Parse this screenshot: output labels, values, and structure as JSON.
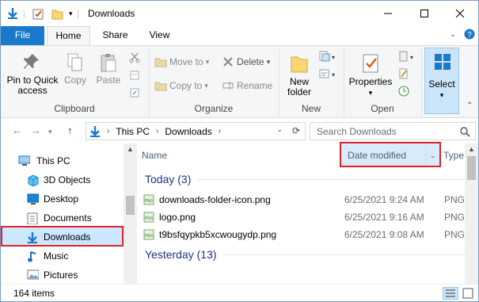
{
  "window": {
    "title": "Downloads"
  },
  "tabs": {
    "file": "File",
    "home": "Home",
    "share": "Share",
    "view": "View"
  },
  "ribbon": {
    "clipboard": {
      "pin_line1": "Pin to Quick",
      "pin_line2": "access",
      "copy": "Copy",
      "paste": "Paste",
      "label": "Clipboard"
    },
    "organize": {
      "move_to": "Move to",
      "copy_to": "Copy to",
      "delete": "Delete",
      "rename": "Rename",
      "label": "Organize"
    },
    "new": {
      "line1": "New",
      "line2": "folder",
      "label": "New"
    },
    "open": {
      "properties": "Properties",
      "label": "Open"
    },
    "select": {
      "label": "Select"
    }
  },
  "address": {
    "segments": [
      "This PC",
      "Downloads"
    ],
    "search_placeholder": "Search Downloads"
  },
  "nav_pane": {
    "items": [
      {
        "label": "This PC"
      },
      {
        "label": "3D Objects"
      },
      {
        "label": "Desktop"
      },
      {
        "label": "Documents"
      },
      {
        "label": "Downloads"
      },
      {
        "label": "Music"
      },
      {
        "label": "Pictures"
      }
    ]
  },
  "columns": {
    "name": "Name",
    "date_modified": "Date modified",
    "type": "Type"
  },
  "groups": [
    {
      "header": "Today (3)",
      "files": [
        {
          "name": "downloads-folder-icon.png",
          "date": "6/25/2021 9:24 AM",
          "type": "PNG"
        },
        {
          "name": "logo.png",
          "date": "6/25/2021 9:16 AM",
          "type": "PNG"
        },
        {
          "name": "t9bsfqypkb5xcwougydp.png",
          "date": "6/25/2021 9:08 AM",
          "type": "PNG"
        }
      ]
    },
    {
      "header": "Yesterday (13)"
    }
  ],
  "status": {
    "count": "164 items"
  },
  "colors": {
    "accent": "#1979ca",
    "highlight": "#e0212b",
    "group_header": "#1e3287"
  }
}
